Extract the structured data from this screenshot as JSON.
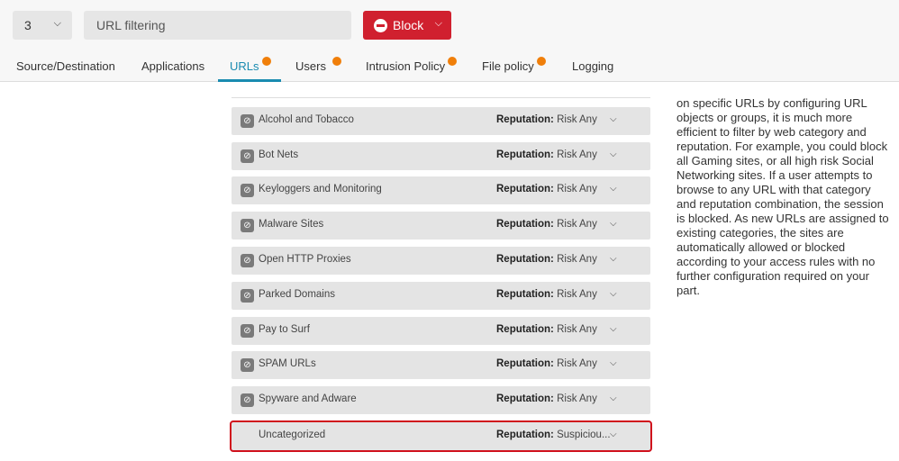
{
  "toolbar": {
    "order_value": "3",
    "rule_name": "URL filtering",
    "action_label": "Block",
    "accent": "#d0202f"
  },
  "tabs": [
    {
      "label": "Source/Destination",
      "badge": false
    },
    {
      "label": "Applications",
      "badge": false
    },
    {
      "label": "URLs",
      "badge": true,
      "active": true
    },
    {
      "label": "Users",
      "badge": true
    },
    {
      "label": "Intrusion Policy",
      "badge": true
    },
    {
      "label": "File policy",
      "badge": true
    },
    {
      "label": "Logging",
      "badge": false
    }
  ],
  "reputation_label": "Reputation:",
  "rows": [
    {
      "name": "Alcohol and Tobacco",
      "reputation": "Risk Any",
      "icon": "link-icon"
    },
    {
      "name": "Bot Nets",
      "reputation": "Risk Any",
      "icon": "link-icon"
    },
    {
      "name": "Keyloggers and Monitoring",
      "reputation": "Risk Any",
      "icon": "link-icon"
    },
    {
      "name": "Malware Sites",
      "reputation": "Risk Any",
      "icon": "link-icon"
    },
    {
      "name": "Open HTTP Proxies",
      "reputation": "Risk Any",
      "icon": "link-icon"
    },
    {
      "name": "Parked Domains",
      "reputation": "Risk Any",
      "icon": "link-icon"
    },
    {
      "name": "Pay to Surf",
      "reputation": "Risk Any",
      "icon": "link-icon"
    },
    {
      "name": "SPAM URLs",
      "reputation": "Risk Any",
      "icon": "link-icon"
    },
    {
      "name": "Spyware and Adware",
      "reputation": "Risk Any",
      "icon": "link-icon"
    },
    {
      "name": "Uncategorized",
      "reputation": "Suspiciou...",
      "highlighted": true
    }
  ],
  "description": "on specific URLs by configuring URL objects or groups, it is much more efficient to filter by web category and reputation. For example, you could block all Gaming sites, or all high risk Social Networking sites. If a user attempts to browse to any URL with that category and reputation combination, the session is blocked. As new URLs are assigned to existing categories, the sites are automatically allowed or blocked according to your access rules with no further configuration required on your part."
}
